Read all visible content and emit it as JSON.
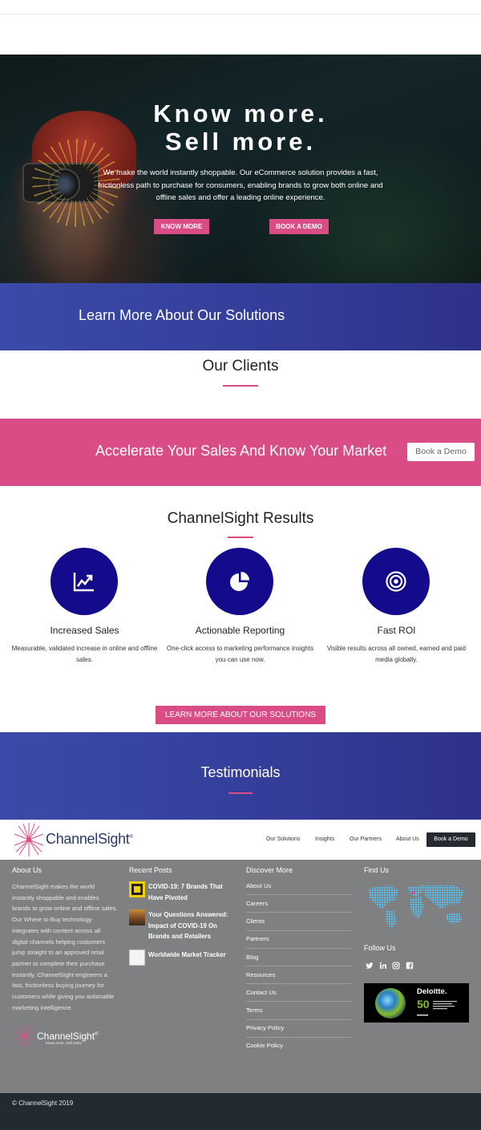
{
  "hero": {
    "title_line1": "Know more.",
    "title_line2": "Sell more.",
    "description": "We make the world instantly shoppable. Our eCommerce solution provides a fast, frictionless path to purchase for consumers, enabling brands to grow both online and offline sales and offer a leading online experience.",
    "know_more_label": "KNOW MORE",
    "book_demo_label": "BOOK A DEMO"
  },
  "solutions_band": {
    "text": "Learn More About Our Solutions"
  },
  "clients": {
    "title": "Our Clients"
  },
  "accelerate_band": {
    "text": "Accelerate Your Sales And Know Your Market",
    "button_label": "Book a Demo"
  },
  "results": {
    "title": "ChannelSight Results",
    "items": [
      {
        "icon": "line-chart-icon",
        "title": "Increased Sales",
        "description": "Measurable, validated increase in online and offline sales."
      },
      {
        "icon": "pie-chart-icon",
        "title": "Actionable Reporting",
        "description": "One-click access to marketing performance insights you can use now."
      },
      {
        "icon": "target-icon",
        "title": "Fast ROI",
        "description": "Visible results across all owned, earned and paid media globally."
      }
    ],
    "learn_more_label": "LEARN MORE ABOUT OUR SOLUTIONS"
  },
  "testimonials": {
    "title": "Testimonials"
  },
  "nav": {
    "logo_text": "ChannelSight",
    "logo_mark": "®",
    "items": [
      "Our Solutions",
      "Insights",
      "Our Partners",
      "About Us"
    ],
    "cta_label": "Book a Demo"
  },
  "footer": {
    "about": {
      "title": "About Us",
      "text": "ChannelSight makes the world instantly shoppable and enables brands to grow online and offline sales. Our Where to Buy technology integrates with content across all digital channels helping customers jump straight to an approved retail partner to complete their purchase instantly. ChannelSight engineers a fast, frictionless buying journey for customers while giving you actionable marketing intelligence.",
      "logo_text": "ChannelSight",
      "logo_mark": "®",
      "logo_tagline": "Know more. Sell more."
    },
    "recent_posts": {
      "title": "Recent Posts",
      "posts": [
        "COVID-19: 7 Brands That Have Pivoted",
        "Your Questions Answered: Impact of COVID-19 On Brands and Retailers",
        "Worldwide Market Tracker"
      ]
    },
    "discover": {
      "title": "Discover More",
      "links": [
        "About Us",
        "Careers",
        "Clients",
        "Partners",
        "Blog",
        "Resources",
        "Contact Us",
        "Terms",
        "Privacy Policy",
        "Cookie Policy"
      ]
    },
    "find_us": {
      "title": "Find Us"
    },
    "follow_us": {
      "title": "Follow Us",
      "icons": [
        "twitter-icon",
        "linkedin-icon",
        "instagram-icon",
        "facebook-icon"
      ]
    },
    "award": {
      "name": "Deloitte.",
      "number": "50"
    }
  },
  "bottom": {
    "copyright": "© ChannelSight 2019"
  },
  "colors": {
    "pink": "#d94c85",
    "navy": "#140a8c",
    "blue_band": "#343e9a",
    "footer_grey": "#7f8081",
    "bottom_dark": "#222a32"
  }
}
